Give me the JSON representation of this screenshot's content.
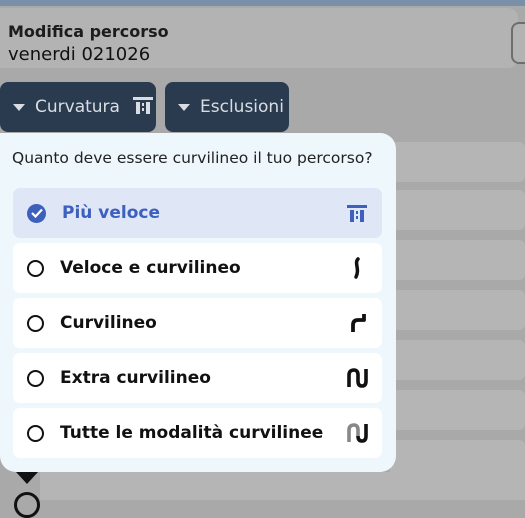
{
  "header": {
    "title": "Modifica percorso",
    "subtitle": "venerdi 021026"
  },
  "toolbar": {
    "curvature_label": "Curvatura",
    "exclusions_label": "Esclusioni"
  },
  "popup": {
    "question": "Quanto deve essere curvilineo il tuo percorso?",
    "options": [
      {
        "label": "Più veloce",
        "selected": true,
        "icon": "highway-icon"
      },
      {
        "label": "Veloce e curvilineo",
        "selected": false,
        "icon": "slight-curve-icon"
      },
      {
        "label": "Curvilineo",
        "selected": false,
        "icon": "curve-icon"
      },
      {
        "label": "Extra curvilineo",
        "selected": false,
        "icon": "extra-curve-icon"
      },
      {
        "label": "Tutte le modalità curvilinee",
        "selected": false,
        "icon": "all-curves-icon"
      }
    ]
  },
  "colors": {
    "accent": "#3d5fbd",
    "chip_bg": "#2a3b4f",
    "popup_bg": "#eef7fc"
  }
}
